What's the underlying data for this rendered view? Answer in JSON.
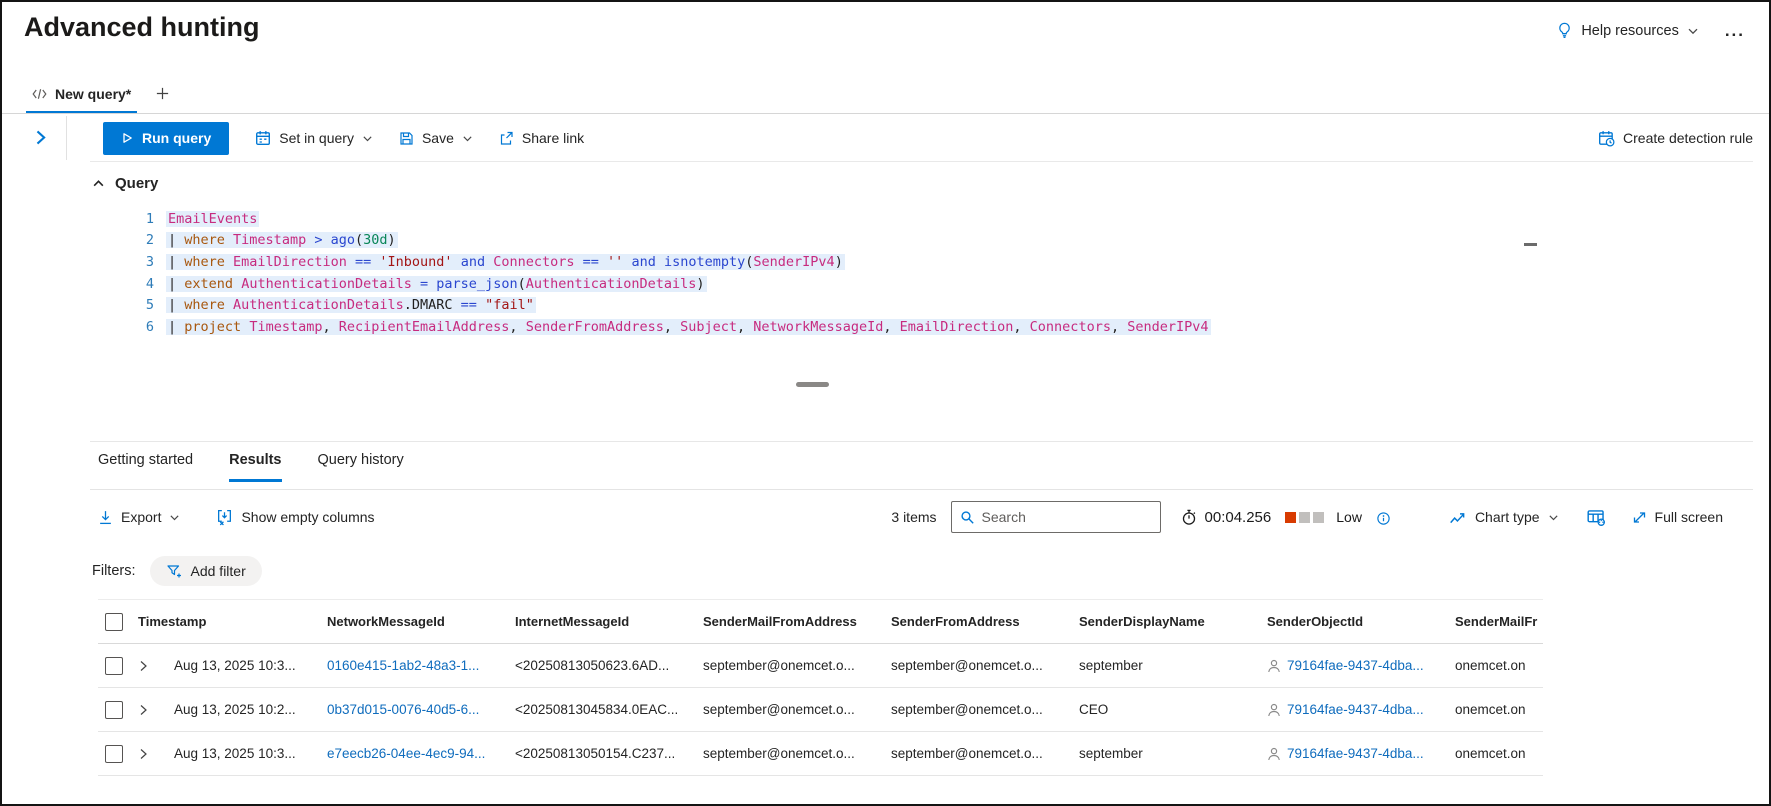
{
  "colors": {
    "accent": "#0078d4",
    "link": "#0f6cbd"
  },
  "header": {
    "title": "Advanced hunting",
    "help_label": "Help resources",
    "more_label": "..."
  },
  "tabs": {
    "new_query": "New query*"
  },
  "toolbar": {
    "run": "Run query",
    "set_in_query": "Set in query",
    "save": "Save",
    "share_link": "Share link",
    "create_detection_rule": "Create detection rule"
  },
  "query": {
    "label": "Query",
    "lines": [
      {
        "num": "1",
        "tokens": [
          [
            "i",
            "EmailEvents"
          ]
        ]
      },
      {
        "num": "2",
        "tokens": [
          [
            "p",
            "| "
          ],
          [
            "k",
            "where"
          ],
          [
            "p",
            " "
          ],
          [
            "i",
            "Timestamp"
          ],
          [
            "p",
            " "
          ],
          [
            "o",
            ">"
          ],
          [
            "p",
            " "
          ],
          [
            "f",
            "ago"
          ],
          [
            "p",
            "("
          ],
          [
            "n",
            "30d"
          ],
          [
            "p",
            ")"
          ]
        ]
      },
      {
        "num": "3",
        "tokens": [
          [
            "p",
            "| "
          ],
          [
            "k",
            "where"
          ],
          [
            "p",
            " "
          ],
          [
            "i",
            "EmailDirection"
          ],
          [
            "p",
            " "
          ],
          [
            "o",
            "=="
          ],
          [
            "p",
            " "
          ],
          [
            "s",
            "'Inbound'"
          ],
          [
            "p",
            " "
          ],
          [
            "o",
            "and"
          ],
          [
            "p",
            " "
          ],
          [
            "i",
            "Connectors"
          ],
          [
            "p",
            " "
          ],
          [
            "o",
            "=="
          ],
          [
            "p",
            " "
          ],
          [
            "s",
            "''"
          ],
          [
            "p",
            " "
          ],
          [
            "o",
            "and"
          ],
          [
            "p",
            " "
          ],
          [
            "f",
            "isnotempty"
          ],
          [
            "p",
            "("
          ],
          [
            "i",
            "SenderIPv4"
          ],
          [
            "p",
            ")"
          ]
        ]
      },
      {
        "num": "4",
        "tokens": [
          [
            "p",
            "| "
          ],
          [
            "k",
            "extend"
          ],
          [
            "p",
            " "
          ],
          [
            "i",
            "AuthenticationDetails"
          ],
          [
            "p",
            " "
          ],
          [
            "o",
            "="
          ],
          [
            "p",
            " "
          ],
          [
            "f",
            "parse_json"
          ],
          [
            "p",
            "("
          ],
          [
            "i",
            "AuthenticationDetails"
          ],
          [
            "p",
            ")"
          ]
        ]
      },
      {
        "num": "5",
        "tokens": [
          [
            "p",
            "| "
          ],
          [
            "k",
            "where"
          ],
          [
            "p",
            " "
          ],
          [
            "i",
            "AuthenticationDetails"
          ],
          [
            "p",
            ".DMARC"
          ],
          [
            "p",
            " "
          ],
          [
            "o",
            "=="
          ],
          [
            "p",
            " "
          ],
          [
            "s",
            "\"fail\""
          ]
        ]
      },
      {
        "num": "6",
        "tokens": [
          [
            "p",
            "| "
          ],
          [
            "k",
            "project"
          ],
          [
            "p",
            " "
          ],
          [
            "i",
            "Timestamp"
          ],
          [
            "p",
            ", "
          ],
          [
            "i",
            "RecipientEmailAddress"
          ],
          [
            "p",
            ", "
          ],
          [
            "i",
            "SenderFromAddress"
          ],
          [
            "p",
            ", "
          ],
          [
            "i",
            "Subject"
          ],
          [
            "p",
            ", "
          ],
          [
            "i",
            "NetworkMessageId"
          ],
          [
            "p",
            ", "
          ],
          [
            "i",
            "EmailDirection"
          ],
          [
            "p",
            ", "
          ],
          [
            "i",
            "Connectors"
          ],
          [
            "p",
            ", "
          ],
          [
            "i",
            "SenderIPv4"
          ]
        ]
      }
    ]
  },
  "result_tabs": [
    {
      "label": "Getting started",
      "active": false
    },
    {
      "label": "Results",
      "active": true
    },
    {
      "label": "Query history",
      "active": false
    }
  ],
  "results_toolbar": {
    "export_label": "Export",
    "show_empty_columns": "Show empty columns",
    "items_count": "3 items",
    "search_placeholder": "Search",
    "duration": "00:04.256",
    "usage": {
      "label": "Low",
      "level": 1,
      "total": 3,
      "active_color": "#d83b01",
      "inactive_color": "#c1bfbd"
    },
    "chart_type": "Chart type",
    "full_screen": "Full screen"
  },
  "filters": {
    "label": "Filters:",
    "add_filter": "Add filter"
  },
  "table": {
    "columns": [
      "Timestamp",
      "NetworkMessageId",
      "InternetMessageId",
      "SenderMailFromAddress",
      "SenderFromAddress",
      "SenderDisplayName",
      "SenderObjectId",
      "SenderMailFr"
    ],
    "rows": [
      [
        "Aug 13, 2025 10:3...",
        "0160e415-1ab2-48a3-1...",
        "<20250813050623.6AD...",
        "september@onemcet.o...",
        "september@onemcet.o...",
        "september",
        "79164fae-9437-4dba...",
        "onemcet.on"
      ],
      [
        "Aug 13, 2025 10:2...",
        "0b37d015-0076-40d5-6...",
        "<20250813045834.0EAC...",
        "september@onemcet.o...",
        "september@onemcet.o...",
        "CEO",
        "79164fae-9437-4dba...",
        "onemcet.on"
      ],
      [
        "Aug 13, 2025 10:3...",
        "e7eecb26-04ee-4ec9-94...",
        "<20250813050154.C237...",
        "september@onemcet.o...",
        "september@onemcet.o...",
        "september",
        "79164fae-9437-4dba...",
        "onemcet.on"
      ]
    ]
  }
}
